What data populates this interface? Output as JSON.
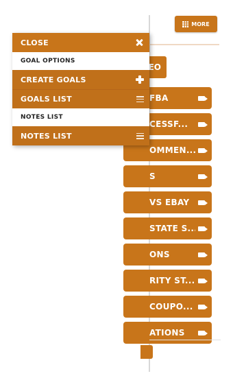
{
  "header": {
    "more_label": "MORE"
  },
  "background": {
    "video_label": "EO",
    "items": [
      "FBA",
      "CESSF...",
      "OMMEN...",
      "S",
      "VS EBAY",
      "STATE S...",
      "ONS",
      "RITY ST...",
      "COUPO...",
      "ATIONS"
    ]
  },
  "drawer": {
    "close_label": "CLOSE",
    "goal_options_header": "GOAL OPTIONS",
    "create_goals_label": "CREATE GOALS",
    "goals_list_label": "GOALS LIST",
    "notes_list_header": "NOTES LIST",
    "notes_list_label": "NOTES LIST"
  },
  "colors": {
    "accent": "#c8751a"
  }
}
